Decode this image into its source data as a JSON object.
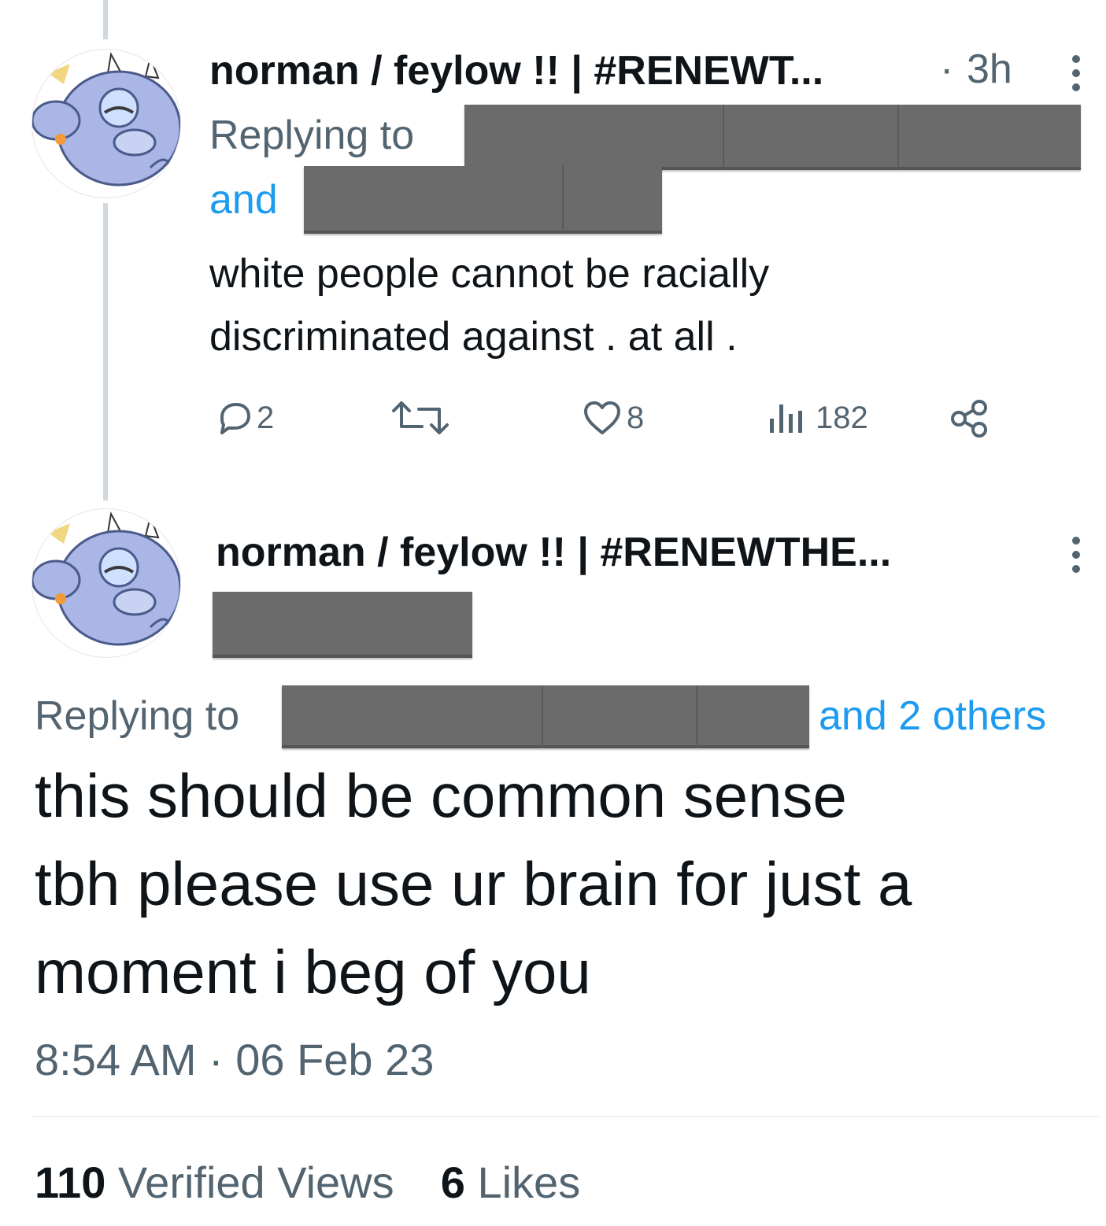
{
  "reply_tweet": {
    "author": "norman / feylow !! | #RENEWT...",
    "time_sep": "·",
    "time": "3h",
    "replying_to_label": "Replying to",
    "and_label": "and",
    "text_line1": "white people cannot be racially",
    "text_line2": "discriminated against . at all .",
    "actions": {
      "replies": "2",
      "retweets": "",
      "likes": "8",
      "views": "182"
    },
    "icons": [
      "reply-icon",
      "retweet-icon",
      "like-icon",
      "views-icon",
      "share-icon",
      "more-icon"
    ]
  },
  "main_tweet": {
    "author": "norman / feylow !! | #RENEWTHE...",
    "replying_to_label": "Replying to",
    "others_label": "and 2 others",
    "text_line1": "this should be common sense",
    "text_line2": "tbh please use ur brain for just a",
    "text_line3": "moment i beg of you",
    "timestamp": "8:54 AM · 06 Feb 23",
    "stats": {
      "views_count": "110",
      "views_label": "Verified Views",
      "likes_count": "6",
      "likes_label": "Likes"
    }
  },
  "colors": {
    "text": "#0f1419",
    "muted": "#536471",
    "link": "#1d9bf0",
    "thread_line": "#cfd9de",
    "redaction": "#6b6b6b",
    "avatar_character": "#aab6e6"
  }
}
